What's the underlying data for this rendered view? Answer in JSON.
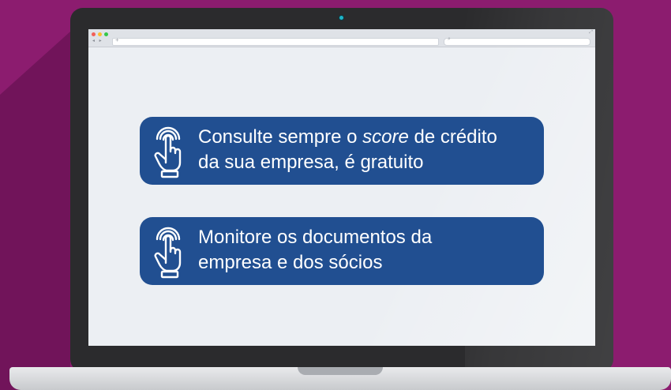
{
  "colors": {
    "background": "#8c1c6f",
    "card": "#214f91",
    "card_text": "#ffffff"
  },
  "browser": {
    "nav_buttons": "◂ ▸",
    "new_tab_glyph": "+",
    "search_glyph": "⌕",
    "resize_glyph": "⤢"
  },
  "tips": [
    {
      "icon": "touch-hand-icon",
      "line1_before": "Consulte sempre o ",
      "line1_emphasis": "score",
      "line1_after": " de crédito",
      "line2": "da sua empresa, é gratuito"
    },
    {
      "icon": "touch-hand-icon",
      "line1": "Monitore os documentos da",
      "line2": "empresa e dos sócios"
    }
  ]
}
